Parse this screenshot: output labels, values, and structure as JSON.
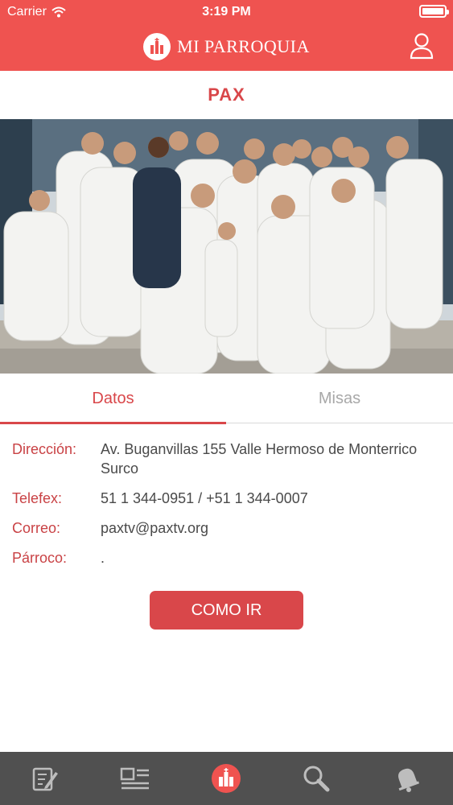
{
  "status_bar": {
    "carrier": "Carrier",
    "time": "3:19 PM"
  },
  "nav": {
    "app_title": "MI PARROQUIA",
    "icons": [
      "church-logo-icon",
      "user-icon"
    ],
    "accent": "#ef5350"
  },
  "parish": {
    "name": "PAX"
  },
  "tabs": [
    {
      "label": "Datos",
      "active": true
    },
    {
      "label": "Misas",
      "active": false
    }
  ],
  "info": {
    "direccion_label": "Dirección:",
    "direccion_value": "Av. Buganvillas 155 Valle Hermoso de Monterrico Surco",
    "telefex_label": "Telefex:",
    "telefex_value": "51 1 344-0951 / +51 1 344-0007",
    "correo_label": "Correo:",
    "correo_value": "paxtv@paxtv.org",
    "parroco_label": "Párroco:",
    "parroco_value": "."
  },
  "actions": {
    "como_ir": "COMO IR"
  },
  "tabbar": {
    "items": [
      "edit-icon",
      "news-list-icon",
      "church-icon",
      "search-icon",
      "bell-icon"
    ],
    "active_index": 2
  },
  "colors": {
    "primary": "#d9474a",
    "header": "#ef5350",
    "tabbar_bg": "#505050",
    "inactive_tab": "#a8a8a8"
  }
}
